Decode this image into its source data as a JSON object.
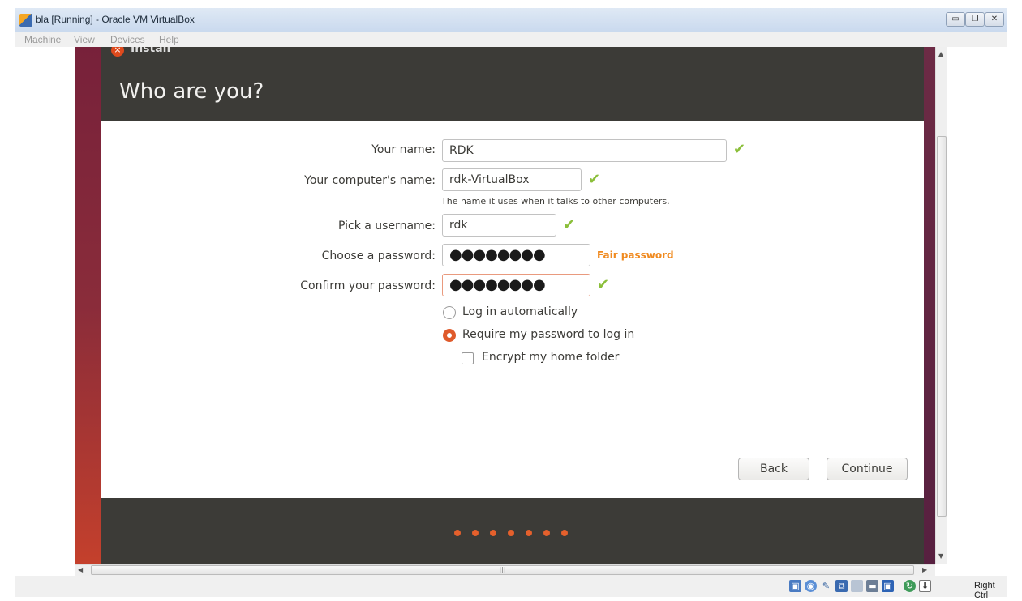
{
  "window": {
    "title": "bla [Running] - Oracle VM VirtualBox",
    "minimize_icon": "minimize-icon",
    "maximize_icon": "restore-icon",
    "close_icon": "close-icon"
  },
  "menu": [
    "Machine",
    "View",
    "Devices",
    "Help"
  ],
  "installer": {
    "window_title": "Install",
    "heading": "Who are you?",
    "fields": {
      "name": {
        "label": "Your name:",
        "value": "RDK"
      },
      "computer": {
        "label": "Your computer's name:",
        "value": "rdk-VirtualBox",
        "hint": "The name it uses when it talks to other computers."
      },
      "username": {
        "label": "Pick a username:",
        "value": "rdk"
      },
      "password": {
        "label": "Choose a password:",
        "value": "●●●●●●●●",
        "strength": "Fair password"
      },
      "confirm": {
        "label": "Confirm your password:",
        "value": "●●●●●●●●"
      }
    },
    "options": {
      "auto_login": {
        "label": "Log in automatically",
        "selected": false
      },
      "require_password": {
        "label": "Require my password to log in",
        "selected": true
      },
      "encrypt_home": {
        "label": "Encrypt my home folder",
        "checked": false
      }
    },
    "buttons": {
      "back": "Back",
      "continue": "Continue"
    },
    "progress": {
      "total_steps": 7
    },
    "colors": {
      "accent": "#df5a2b",
      "check": "#8bbf3a",
      "header": "#3c3b37",
      "warning": "#f08a1f"
    }
  },
  "statusbar": {
    "icons": [
      "hard-disk-icon",
      "optical-drive-icon",
      "usb-icon",
      "network-icon",
      "shared-folders-icon",
      "video-capture-icon",
      "virtualization-icon",
      "mouse-integration-icon",
      "keyboard-capture-icon"
    ],
    "host_key": "Right Ctrl"
  }
}
